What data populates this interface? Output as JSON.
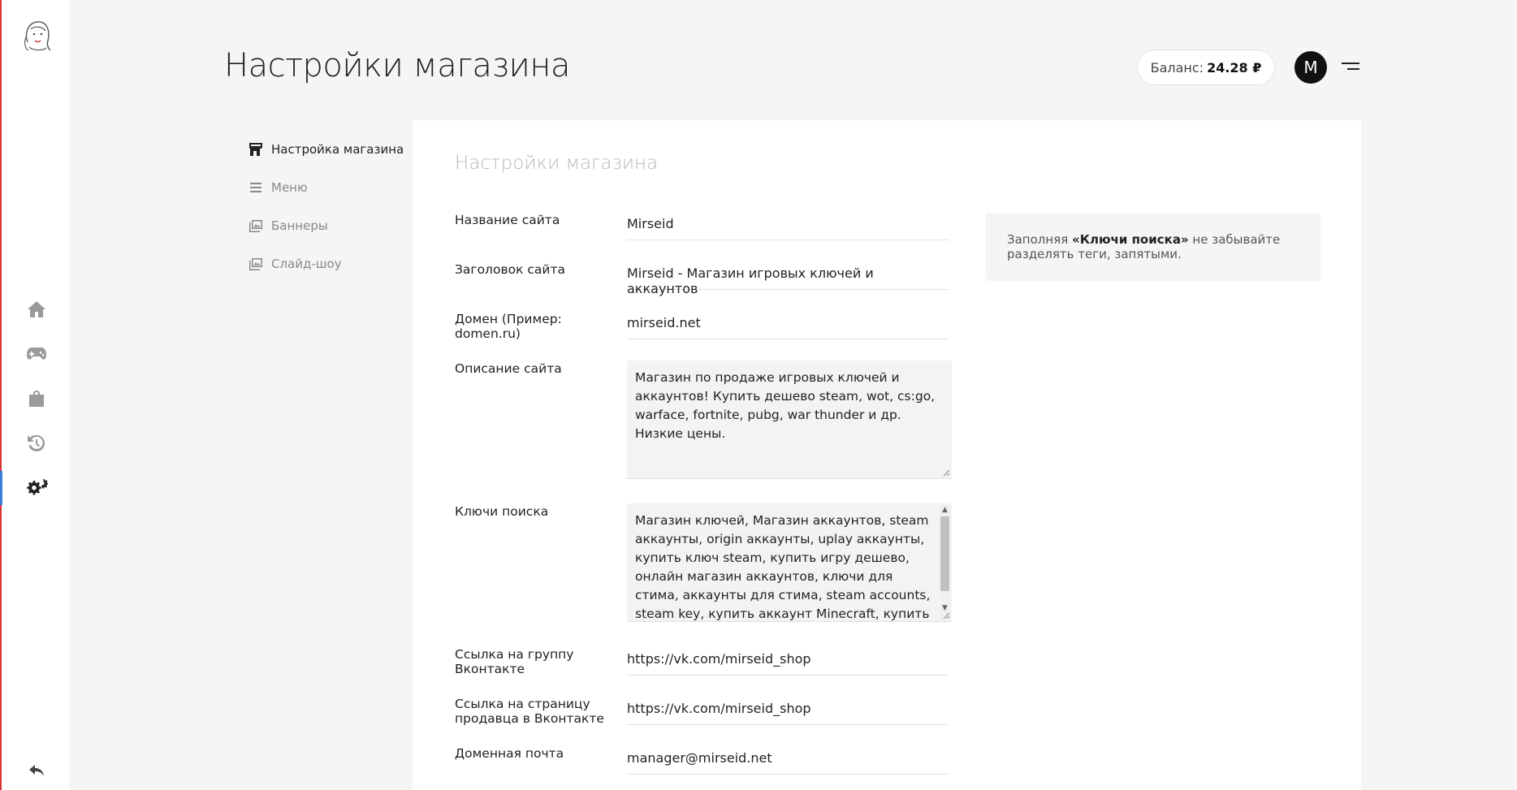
{
  "header": {
    "title": "Настройки магазина",
    "balance_label": "Баланс:",
    "balance_value": "24.28 ₽",
    "avatar_letter": "M"
  },
  "rail": {
    "icons": [
      "logo-icon",
      "home-icon",
      "gamepad-icon",
      "bag-icon",
      "history-icon",
      "settings-icon",
      "back-icon"
    ],
    "active": "settings-icon"
  },
  "settings_nav": {
    "items": [
      {
        "label": "Настройка магазина",
        "icon": "store-icon",
        "active": true
      },
      {
        "label": "Меню",
        "icon": "menu-lines-icon",
        "active": false
      },
      {
        "label": "Баннеры",
        "icon": "images-icon",
        "active": false
      },
      {
        "label": "Слайд-шоу",
        "icon": "slideshow-icon",
        "active": false
      }
    ]
  },
  "form": {
    "title": "Настройки магазина",
    "site_name": {
      "label": "Название сайта",
      "value": "Mirseid"
    },
    "site_heading": {
      "label": "Заголовок сайта",
      "value": "Mirseid - Магазин игровых ключей и аккаунтов"
    },
    "domain": {
      "label": "Домен (Пример: domen.ru)",
      "value": "mirseid.net"
    },
    "description": {
      "label": "Описание сайта",
      "value": "Магазин по продаже игровых ключей и аккаунтов! Купить дешево steam, wot, cs:go, warface, fortnite, pubg, war thunder и др. Низкие цены."
    },
    "search_keys": {
      "label": "Ключи поиска",
      "value": "Магазин ключей, Магазин аккаунтов, steam аккаунты, origin аккаунты, uplay аккаунты, купить ключ steam, купить игру дешево, онлайн магазин аккаунтов, ключи для стима, аккаунты для стима, steam accounts, steam key, купить аккаунт Minecraft, купить аккаунт с"
    },
    "vk_group": {
      "label": "Ссылка на группу Вконтакте",
      "value": "https://vk.com/mirseid_shop"
    },
    "vk_seller": {
      "label": "Ссылка на страницу продавца в Вконтакте",
      "value": "https://vk.com/mirseid_shop"
    },
    "domain_email": {
      "label": "Доменная почта",
      "value": "manager@mirseid.net"
    }
  },
  "hint": {
    "prefix": "Заполняя ",
    "bold": "«Ключи поиска»",
    "suffix": " не забывайте разделять теги, запятыми."
  }
}
